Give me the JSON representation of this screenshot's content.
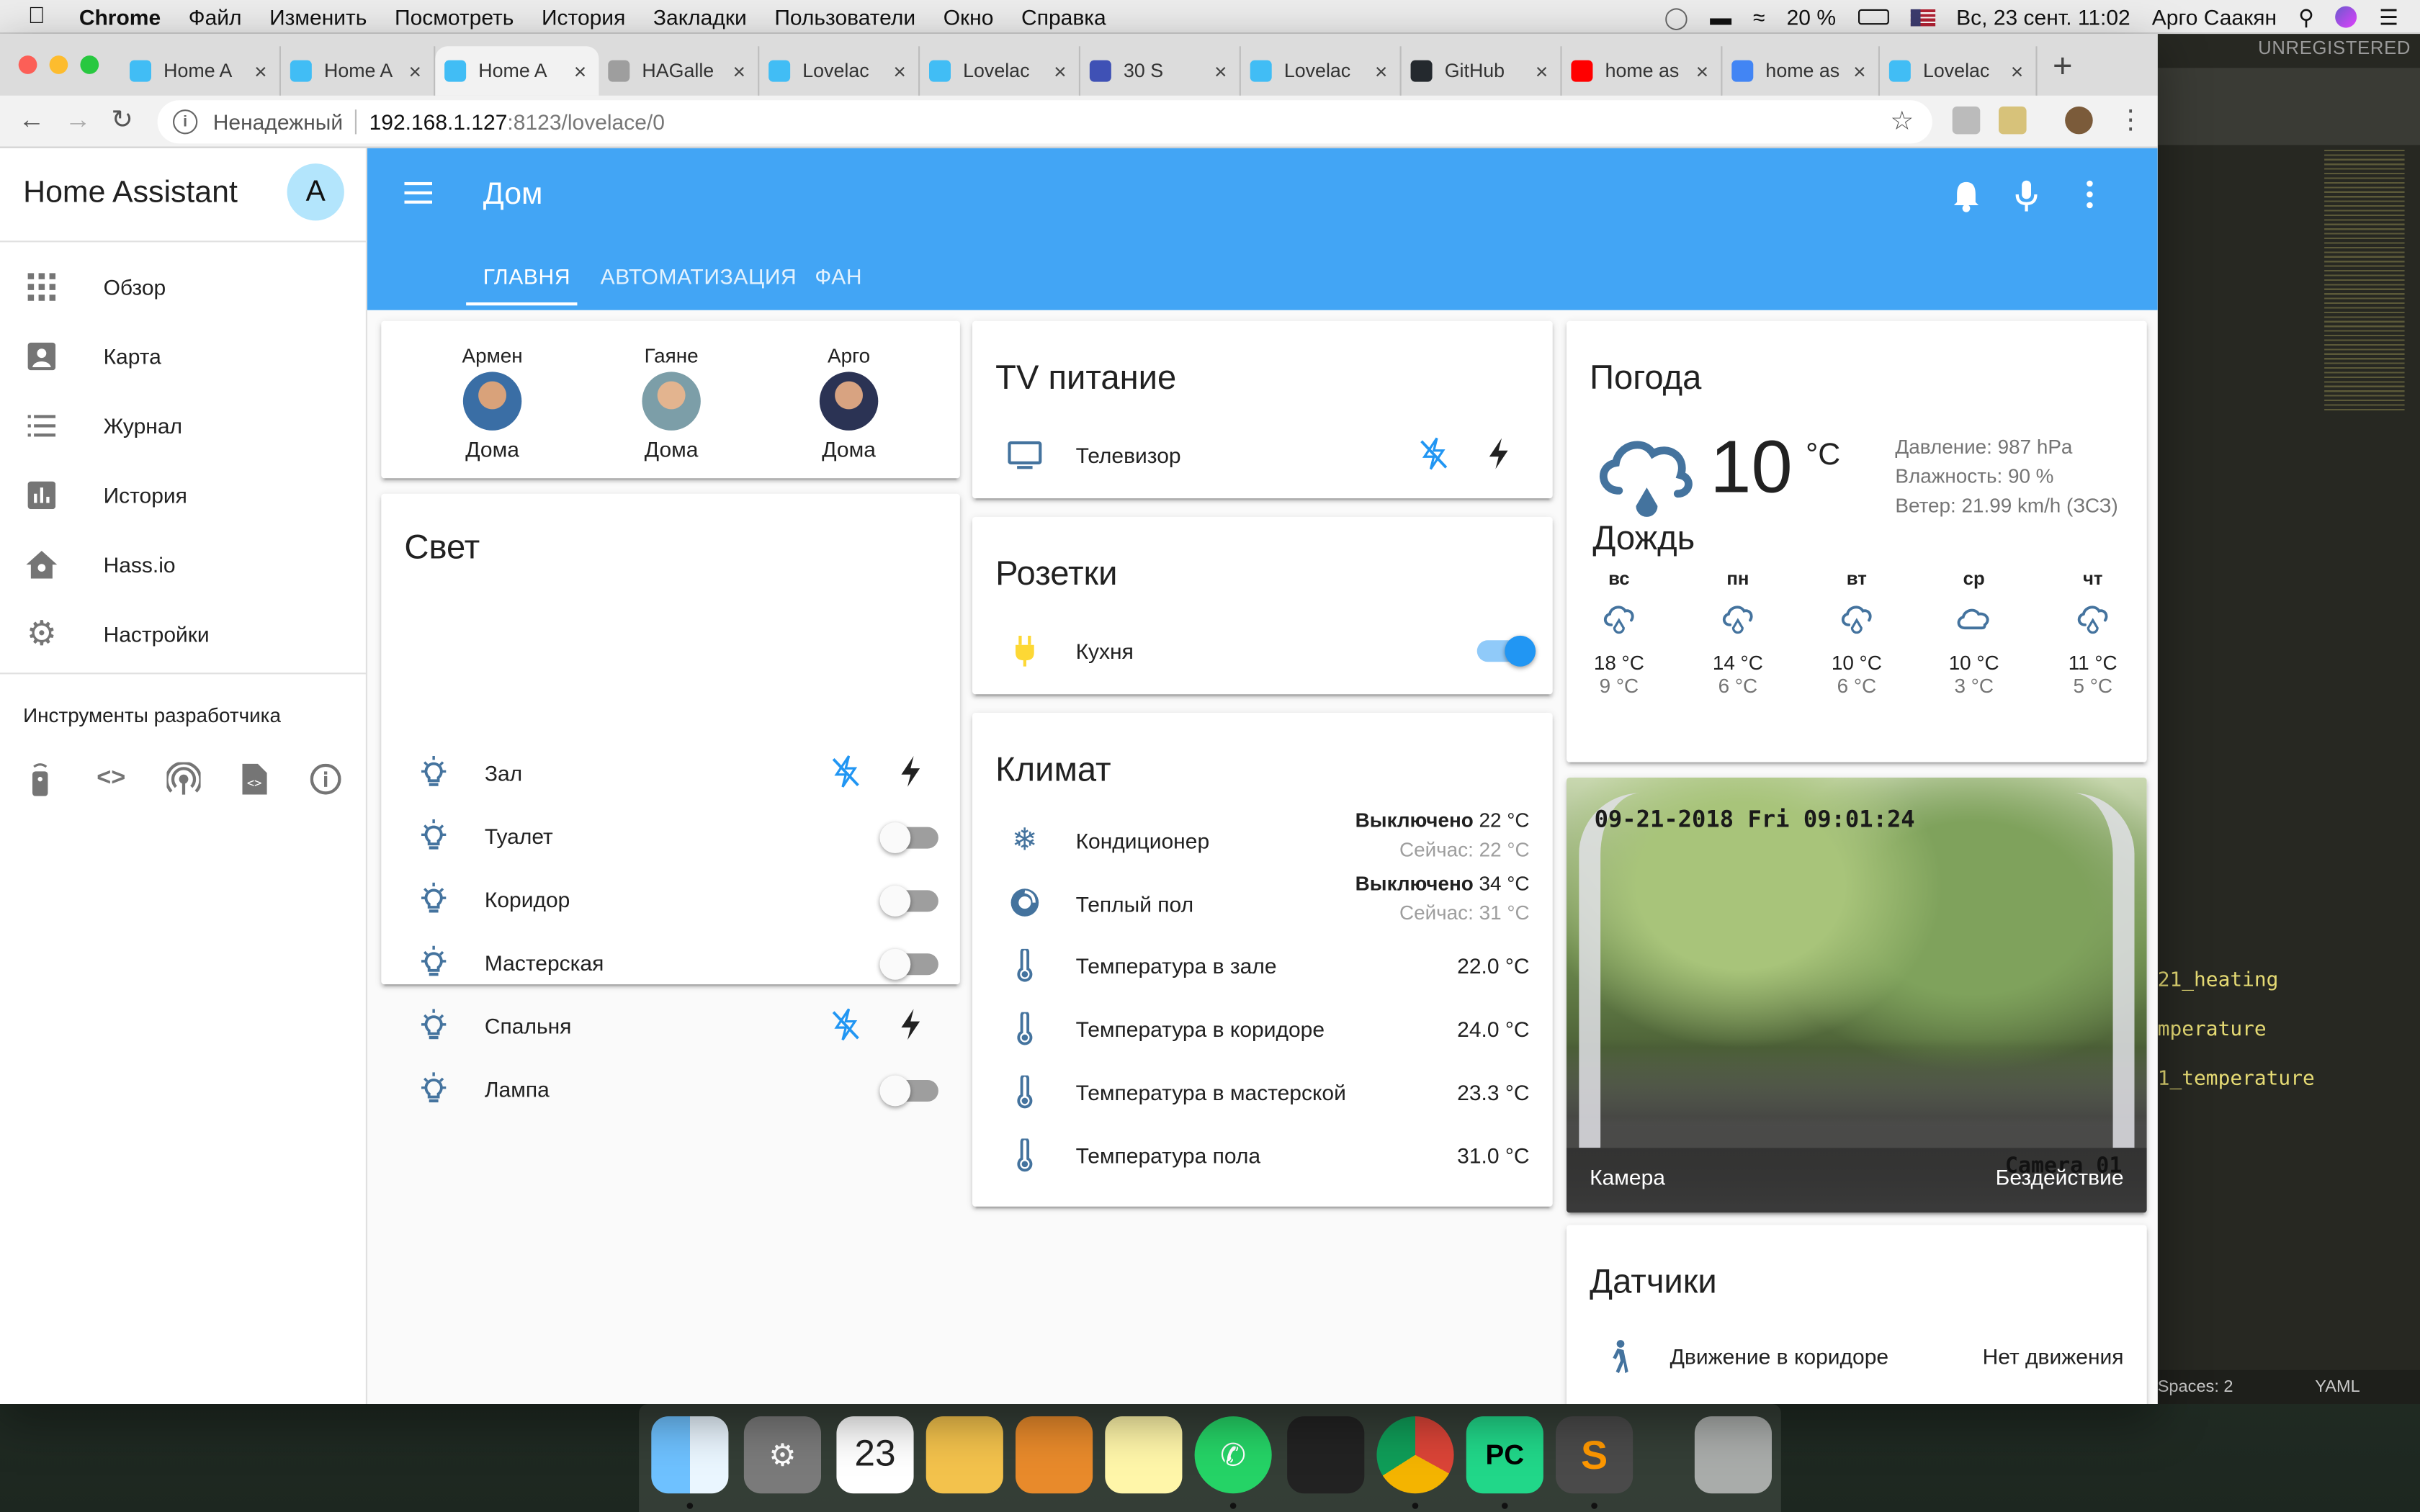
{
  "menubar": {
    "app": "Chrome",
    "items": [
      "Файл",
      "Изменить",
      "Посмотреть",
      "История",
      "Закладки",
      "Пользователи",
      "Окно",
      "Справка"
    ],
    "battery": "20 %",
    "datetime": "Вс, 23 сент. 11:02",
    "user": "Арго Саакян"
  },
  "browser": {
    "tabs": [
      {
        "title": "Home A",
        "favicon": "home-assistant-icon"
      },
      {
        "title": "Home A",
        "favicon": "home-assistant-icon"
      },
      {
        "title": "Home A",
        "favicon": "home-assistant-icon",
        "active": true
      },
      {
        "title": "HAGalle",
        "favicon": "document-icon"
      },
      {
        "title": "Lovelac",
        "favicon": "home-assistant-icon"
      },
      {
        "title": "Lovelac",
        "favicon": "home-assistant-icon"
      },
      {
        "title": "30 S",
        "favicon": "video-icon"
      },
      {
        "title": "Lovelac",
        "favicon": "home-assistant-icon"
      },
      {
        "title": "GitHub",
        "favicon": "github-icon"
      },
      {
        "title": "home as",
        "favicon": "youtube-icon"
      },
      {
        "title": "home as",
        "favicon": "google-icon"
      },
      {
        "title": "Lovelac",
        "favicon": "home-assistant-icon"
      }
    ],
    "security": "Ненадежный",
    "url_host": "192.168.1.127",
    "url_path": ":8123/lovelace/0"
  },
  "sidebar": {
    "title": "Home Assistant",
    "avatar": "A",
    "items": [
      {
        "label": "Обзор",
        "icon": "apps-icon"
      },
      {
        "label": "Карта",
        "icon": "map-icon"
      },
      {
        "label": "Журнал",
        "icon": "list-icon"
      },
      {
        "label": "История",
        "icon": "chart-icon"
      },
      {
        "label": "Hass.io",
        "icon": "hassio-icon"
      },
      {
        "label": "Настройки",
        "icon": "gear-icon"
      }
    ],
    "dev_title": "Инструменты разработчика",
    "dev_tools": [
      "remote-icon",
      "code-icon",
      "broadcast-icon",
      "file-code-icon",
      "info-icon"
    ]
  },
  "header": {
    "title": "Дом",
    "tabs": [
      "ГЛАВНЯ",
      "АВТОМАТИЗАЦИЯ",
      "ФАН"
    ],
    "active_tab": 0
  },
  "people": [
    {
      "name": "Армен",
      "state": "Дома"
    },
    {
      "name": "Гаяне",
      "state": "Дома"
    },
    {
      "name": "Арго",
      "state": "Дома"
    }
  ],
  "lights": {
    "title": "Свет",
    "items": [
      {
        "name": "Зал",
        "control": "buttons"
      },
      {
        "name": "Туалет",
        "control": "toggle",
        "on": false
      },
      {
        "name": "Коридор",
        "control": "toggle",
        "on": false
      },
      {
        "name": "Мастерская",
        "control": "toggle",
        "on": false
      },
      {
        "name": "Спальня",
        "control": "buttons"
      },
      {
        "name": "Лампа",
        "control": "toggle",
        "on": false
      }
    ]
  },
  "tv": {
    "title": "TV питание",
    "item": "Телевизор"
  },
  "sockets": {
    "title": "Розетки",
    "item": "Кухня",
    "on": true
  },
  "climate": {
    "title": "Климат",
    "hvac": [
      {
        "name": "Кондиционер",
        "state": "Выключено",
        "target": "22 °C",
        "current": "Сейчас: 22 °C",
        "icon": "snowflake-icon"
      },
      {
        "name": "Теплый пол",
        "state": "Выключено",
        "target": "34 °C",
        "current": "Сейчас: 31 °C",
        "icon": "heating-icon"
      }
    ],
    "sensors": [
      {
        "name": "Температура в зале",
        "value": "22.0 °C"
      },
      {
        "name": "Температура в коридоре",
        "value": "24.0 °C"
      },
      {
        "name": "Температура в мастерской",
        "value": "23.3 °C"
      },
      {
        "name": "Температура пола",
        "value": "31.0 °C"
      }
    ]
  },
  "weather": {
    "title": "Погода",
    "temp": "10",
    "unit": "°C",
    "condition": "Дождь",
    "pressure": "Давление: 987 hPa",
    "humidity": "Влажность: 90 %",
    "wind": "Ветер: 21.99 km/h (ЗСЗ)",
    "forecast": [
      {
        "day": "вс",
        "hi": "18 °C",
        "lo": "9 °C",
        "icon": "rain-icon"
      },
      {
        "day": "пн",
        "hi": "14 °C",
        "lo": "6 °C",
        "icon": "rain-icon"
      },
      {
        "day": "вт",
        "hi": "10 °C",
        "lo": "6 °C",
        "icon": "rain-icon"
      },
      {
        "day": "ср",
        "hi": "10 °C",
        "lo": "3 °C",
        "icon": "cloud-icon"
      },
      {
        "day": "чт",
        "hi": "11 °C",
        "lo": "5 °C",
        "icon": "rain-icon"
      }
    ]
  },
  "camera": {
    "name": "Камера",
    "state": "Бездействие",
    "overlay": "09-21-2018 Fri 09:01:24",
    "label": "Camera 01"
  },
  "sensors_card": {
    "title": "Датчики",
    "item": "Движение в коридоре",
    "value": "Нет движения"
  },
  "editor": {
    "banner": "UNREGISTERED",
    "lines": [
      "21_heating",
      "mperature",
      "1_temperature"
    ],
    "status_spaces": "Spaces: 2",
    "status_syntax": "YAML"
  },
  "colors": {
    "primary": "#42a5f5",
    "icon": "#44739e",
    "accent": "#2196f3"
  }
}
